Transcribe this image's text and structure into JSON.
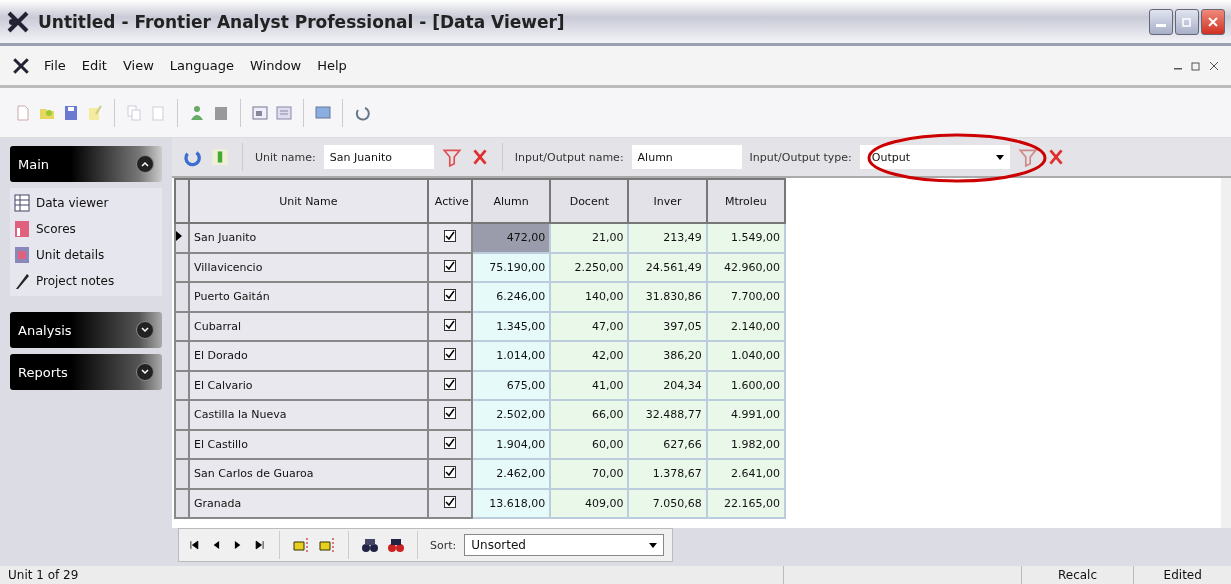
{
  "window": {
    "title": "Untitled - Frontier Analyst Professional - [Data Viewer]"
  },
  "menu": [
    "File",
    "Edit",
    "View",
    "Language",
    "Window",
    "Help"
  ],
  "sidebar": [
    {
      "label": "Main",
      "expanded": true,
      "items": [
        {
          "label": "Data viewer",
          "kind": "grid"
        },
        {
          "label": "Scores",
          "kind": "chart"
        },
        {
          "label": "Unit details",
          "kind": "details"
        },
        {
          "label": "Project notes",
          "kind": "notes"
        }
      ]
    },
    {
      "label": "Analysis",
      "expanded": false
    },
    {
      "label": "Reports",
      "expanded": false
    }
  ],
  "filter": {
    "unit_label": "Unit name:",
    "unit_value": "San Juanito",
    "io_name_label": "Input/Output name:",
    "io_name_value": "Alumn",
    "io_type_label": "Input/Output type:",
    "io_type_value": "Output"
  },
  "table": {
    "columns": [
      "Unit Name",
      "Active",
      "Alumn",
      "Docent",
      "Inver",
      "Mtroleu"
    ],
    "rows": [
      {
        "selected": true,
        "unit_name": "San Juanito",
        "active": true,
        "values": [
          "472,00",
          "21,00",
          "213,49",
          "1.549,00"
        ]
      },
      {
        "selected": false,
        "unit_name": "Villavicencio",
        "active": true,
        "values": [
          "75.190,00",
          "2.250,00",
          "24.561,49",
          "42.960,00"
        ]
      },
      {
        "selected": false,
        "unit_name": "Puerto Gaitán",
        "active": true,
        "values": [
          "6.246,00",
          "140,00",
          "31.830,86",
          "7.700,00"
        ]
      },
      {
        "selected": false,
        "unit_name": "Cubarral",
        "active": true,
        "values": [
          "1.345,00",
          "47,00",
          "397,05",
          "2.140,00"
        ]
      },
      {
        "selected": false,
        "unit_name": "El Dorado",
        "active": true,
        "values": [
          "1.014,00",
          "42,00",
          "386,20",
          "1.040,00"
        ]
      },
      {
        "selected": false,
        "unit_name": "El Calvario",
        "active": true,
        "values": [
          "675,00",
          "41,00",
          "204,34",
          "1.600,00"
        ]
      },
      {
        "selected": false,
        "unit_name": "Castilla la Nueva",
        "active": true,
        "values": [
          "2.502,00",
          "66,00",
          "32.488,77",
          "4.991,00"
        ]
      },
      {
        "selected": false,
        "unit_name": "El Castillo",
        "active": true,
        "values": [
          "1.904,00",
          "60,00",
          "627,66",
          "1.982,00"
        ]
      },
      {
        "selected": false,
        "unit_name": "San Carlos de Guaroa",
        "active": true,
        "values": [
          "2.462,00",
          "70,00",
          "1.378,67",
          "2.641,00"
        ]
      },
      {
        "selected": false,
        "unit_name": "Granada",
        "active": true,
        "values": [
          "13.618,00",
          "409,00",
          "7.050,68",
          "22.165,00"
        ]
      }
    ]
  },
  "navigator": {
    "sort_label": "Sort:",
    "sort_value": "Unsorted"
  },
  "status_bar": {
    "position": "Unit 1 of 29",
    "recalc": "Recalc",
    "edited": "Edited"
  }
}
